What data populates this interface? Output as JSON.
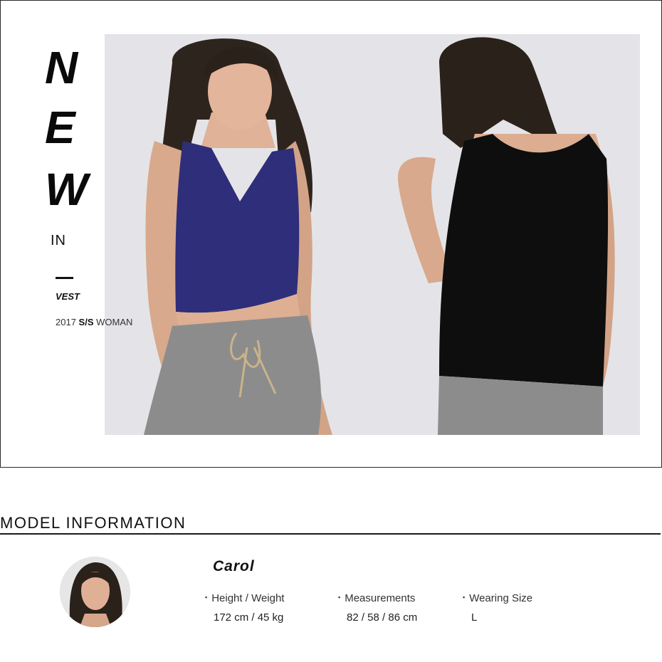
{
  "hero": {
    "letters": [
      "N",
      "E",
      "W"
    ],
    "in_label": "IN",
    "category": "VEST",
    "season_prefix": "2017 ",
    "season_strong": "S/S",
    "season_suffix": " WOMAN",
    "photo_alt": "Model wearing navy and black vests"
  },
  "model_info": {
    "title": "MODEL INFORMATION",
    "name": "Carol",
    "stats": [
      {
        "label": "Height / Weight",
        "value": "172 cm / 45 kg"
      },
      {
        "label": "Measurements",
        "value": "82 / 58 / 86 cm"
      },
      {
        "label": "Wearing Size",
        "value": "L"
      }
    ]
  },
  "colors": {
    "navy_vest": "#2e2e7a",
    "black_vest": "#0e0e0e",
    "background_photo": "#e4e4e8",
    "pants": "#8c8c8c"
  }
}
